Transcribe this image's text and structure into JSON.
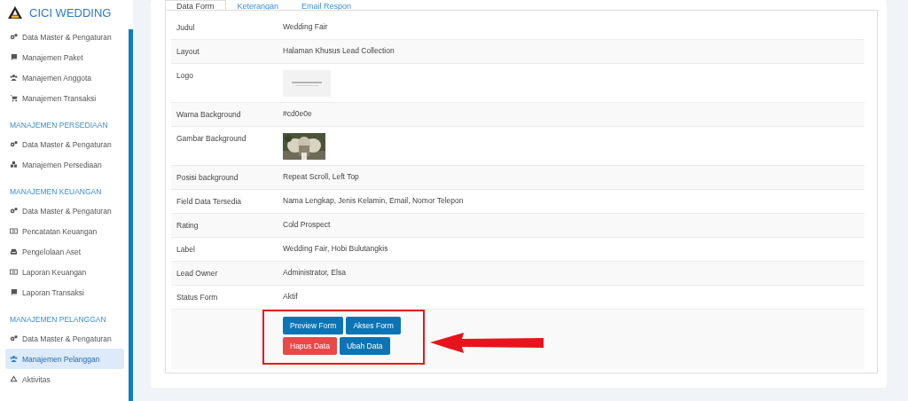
{
  "brand": {
    "name": "CICI WEDDING"
  },
  "sidebar": {
    "sections": [
      {
        "items": [
          {
            "label": "Data Master & Pengaturan",
            "kind": "gears",
            "selected": false
          },
          {
            "label": "Manajemen Paket",
            "kind": "book",
            "selected": false
          },
          {
            "label": "Manajemen Anggota",
            "kind": "users",
            "selected": false
          },
          {
            "label": "Manajemen Transaksi",
            "kind": "cart",
            "selected": false
          }
        ]
      },
      {
        "title": "MANAJEMEN PERSEDIAAN",
        "items": [
          {
            "label": "Data Master & Pengaturan",
            "kind": "gears",
            "selected": false
          },
          {
            "label": "Manajemen Persediaan",
            "kind": "boxes",
            "selected": false
          }
        ]
      },
      {
        "title": "MANAJEMEN KEUANGAN",
        "items": [
          {
            "label": "Data Master & Pengaturan",
            "kind": "gears",
            "selected": false
          },
          {
            "label": "Pencatatan Keuangan",
            "kind": "money",
            "selected": false
          },
          {
            "label": "Pengelolaan Aset",
            "kind": "tray",
            "selected": false
          },
          {
            "label": "Laporan Keuangan",
            "kind": "money",
            "selected": false
          },
          {
            "label": "Laporan Transaksi",
            "kind": "book",
            "selected": false
          }
        ]
      },
      {
        "title": "MANAJEMEN PELANGGAN",
        "items": [
          {
            "label": "Data Master & Pengaturan",
            "kind": "gears",
            "selected": false
          },
          {
            "label": "Manajemen Pelanggan",
            "kind": "users",
            "selected": true
          },
          {
            "label": "Aktivitas",
            "kind": "recycle",
            "selected": false
          }
        ]
      }
    ]
  },
  "tabs": [
    {
      "label": "Data Form",
      "selected": true
    },
    {
      "label": "Keterangan",
      "selected": false
    },
    {
      "label": "Email Respon",
      "selected": false
    }
  ],
  "details": [
    {
      "kind": "text",
      "label": "Judul",
      "value": "Wedding Fair"
    },
    {
      "kind": "text",
      "label": "Layout",
      "value": "Halaman Khusus Lead Collection"
    },
    {
      "kind": "logo",
      "label": "Logo"
    },
    {
      "kind": "text",
      "label": "Warna Background",
      "value": "#cd0e0e"
    },
    {
      "label": "Gambar Background"
    },
    {
      "kind": "text",
      "label": "Posisi background",
      "value": "Repeat Scroll, Left Top"
    },
    {
      "kind": "text",
      "label": "Field Data Tersedia",
      "value": "Nama Lengkap, Jenis Kelamin, Email, Nomor Telepon"
    },
    {
      "kind": "text",
      "label": "Rating",
      "value": "Cold Prospect"
    },
    {
      "kind": "text",
      "label": "Label",
      "value": "Wedding Fair, Hobi Bulutangkis"
    },
    {
      "kind": "text",
      "label": "Lead Owner",
      "value": "Administrator, Elsa"
    },
    {
      "kind": "text",
      "label": "Status Form",
      "value": "Aktif"
    }
  ],
  "actions": [
    [
      {
        "label": "Preview Form",
        "kind": "primary"
      },
      {
        "label": "Akses Form",
        "kind": "primary"
      }
    ],
    [
      {
        "label": "Hapus Data",
        "kind": "danger"
      },
      {
        "label": "Ubah Data",
        "kind": "primary"
      }
    ]
  ],
  "highlight": {
    "shown": true
  }
}
